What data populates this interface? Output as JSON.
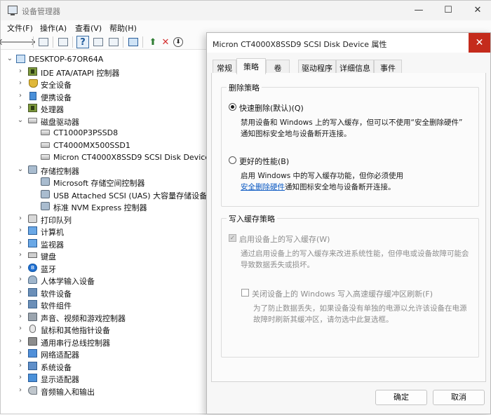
{
  "main": {
    "title": "设备管理器",
    "menu": [
      "文件(F)",
      "操作(A)",
      "查看(V)",
      "帮助(H)"
    ],
    "window_controls": {
      "minimize": "—",
      "maximize": "☐",
      "close": "✕"
    }
  },
  "toolbar": {
    "back": "🡐",
    "forward": "🡒",
    "help": "?",
    "update": "⬆",
    "remove": "✕",
    "download": "⬇"
  },
  "tree": {
    "root": "DESKTOP-67OR64A",
    "items": [
      "IDE ATA/ATAPI 控制器",
      "安全设备",
      "便携设备",
      "处理器",
      "磁盘驱动器",
      "CT1000P3PSSD8",
      "CT4000MX500SSD1",
      "Micron CT4000X8SSD9 SCSI Disk Device",
      "存储控制器",
      "Microsoft 存储空间控制器",
      "USB Attached SCSI (UAS) 大容量存储设备",
      "标准 NVM Express 控制器",
      "打印队列",
      "计算机",
      "监视器",
      "键盘",
      "蓝牙",
      "人体学输入设备",
      "软件设备",
      "软件组件",
      "声音、视频和游戏控制器",
      "鼠标和其他指针设备",
      "通用串行总线控制器",
      "网络适配器",
      "系统设备",
      "显示适配器",
      "音频输入和输出"
    ],
    "expander_collapsed": "›",
    "expander_expanded": "⌄"
  },
  "dialog": {
    "title": "Micron CT4000X8SSD9 SCSI Disk Device 属性",
    "close": "✕",
    "tabs": [
      "常规",
      "策略",
      "卷",
      "驱动程序",
      "详细信息",
      "事件"
    ],
    "removal_group": {
      "title": "删除策略",
      "quick_label": "快速删除(默认)(Q)",
      "quick_desc_1": "禁用设备和 Windows 上的写入缓存，但可以不使用“安全删除硬件”",
      "quick_desc_2": "通知图标安全地与设备断开连接。",
      "better_label": "更好的性能(B)",
      "better_desc_1": "启用 Windows 中的写入缓存功能，但你必须使用",
      "better_desc_link": "安全删除硬件",
      "better_desc_2": "通知图标安全地与设备断开连接。"
    },
    "cache_group": {
      "title": "写入缓存策略",
      "enable_label": "启用设备上的写入缓存(W)",
      "enable_desc_1": "通过启用设备上的写入缓存来改进系统性能，但停电或设备故障可能会",
      "enable_desc_2": "导致数据丢失或损坏。",
      "flush_label": "关闭设备上的 Windows 写入高速缓存缓冲区刷新(F)",
      "flush_desc_1": "为了防止数据丢失，如果设备没有单独的电源以允许该设备在电源",
      "flush_desc_2": "故障时刷新其缓冲区，请勿选中此复选框。"
    },
    "ok": "确定",
    "cancel": "取消"
  }
}
